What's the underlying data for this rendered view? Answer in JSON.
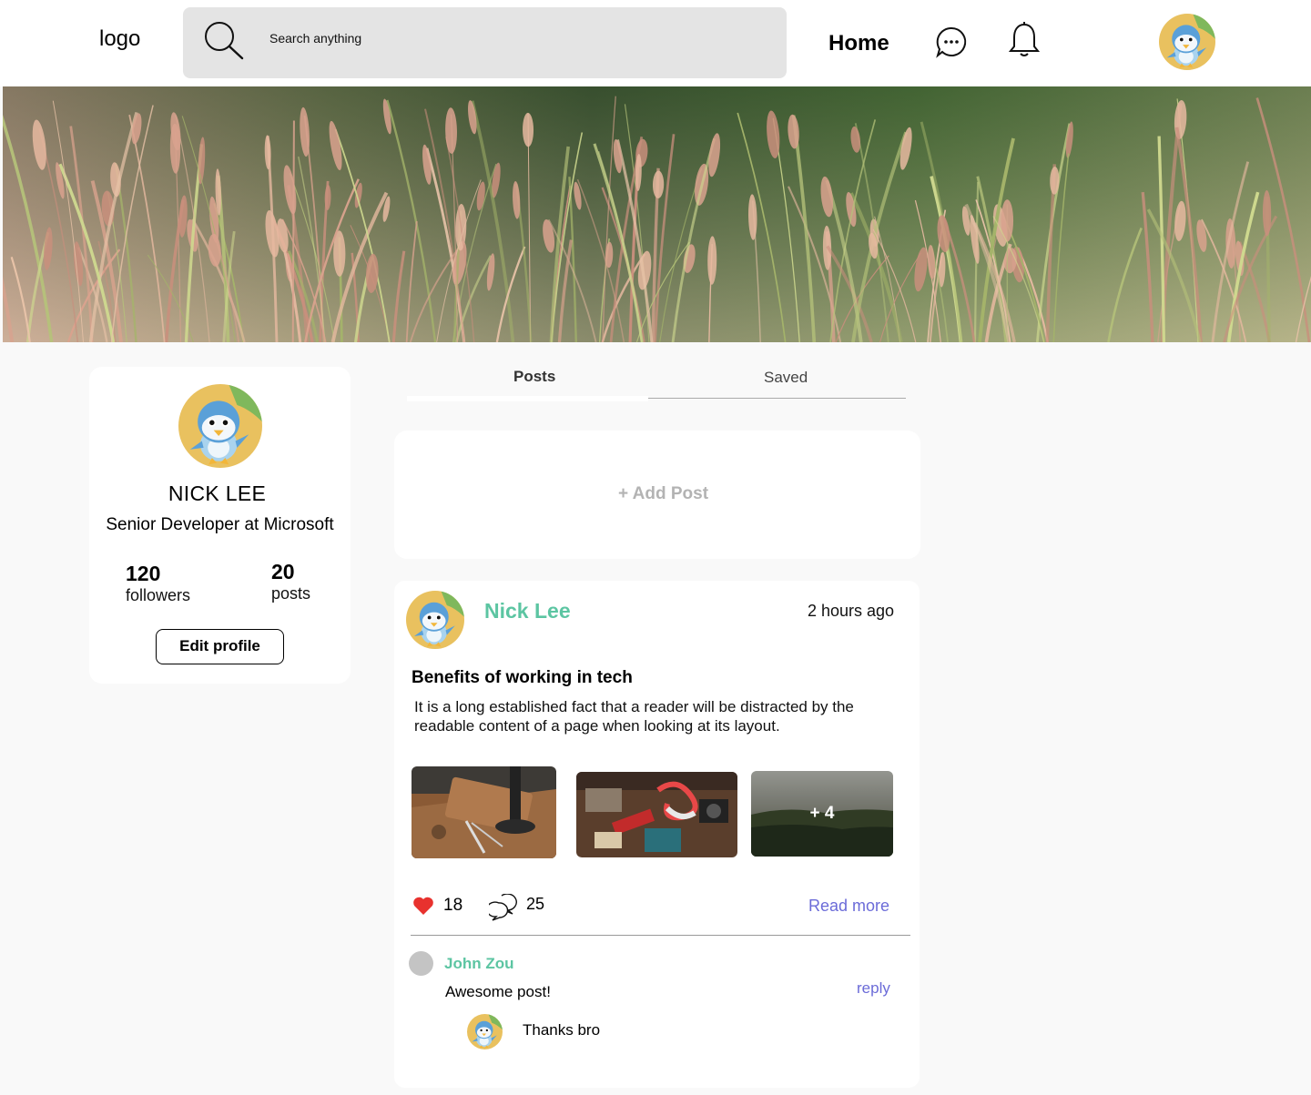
{
  "header": {
    "logo_text": "logo",
    "search_placeholder": "Search anything",
    "nav_home": "Home",
    "icons": [
      "search-icon",
      "chat-icon",
      "bell-icon",
      "user-avatar"
    ]
  },
  "tabs": [
    {
      "label": "Posts",
      "active": true
    },
    {
      "label": "Saved",
      "active": false
    }
  ],
  "profile": {
    "name": "NICK LEE",
    "title": "Senior Developer at Microsoft",
    "followers_count": "120",
    "followers_label": "followers",
    "posts_count": "20",
    "posts_label": "posts",
    "edit_label": "Edit profile"
  },
  "composer": {
    "add_post_label": "+ Add Post"
  },
  "post": {
    "author": "Nick Lee",
    "time": "2 hours ago",
    "title": "Benefits of working in tech",
    "body": "It is a long established fact that a reader will be distracted by the readable content of a page when looking at its layout.",
    "more_images_label": "+ 4",
    "likes": "18",
    "comments": "25",
    "read_more": "Read more"
  },
  "comment": {
    "author": "John Zou",
    "text": "Awesome post!",
    "reply_label": "reply",
    "reply_text": "Thanks bro"
  },
  "colors": {
    "accent_green": "#5cc5a2",
    "link_blue": "#6b6bd8",
    "like_red": "#e8322e",
    "page_bg": "#f9f9f9"
  }
}
